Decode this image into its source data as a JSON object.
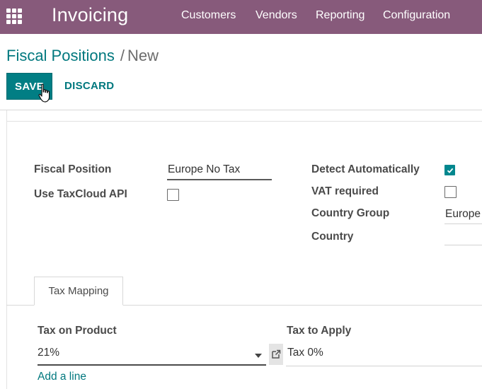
{
  "app": {
    "title": "Invoicing",
    "apps_icon": "grid-apps-icon"
  },
  "nav": {
    "items": [
      "Customers",
      "Vendors",
      "Reporting",
      "Configuration"
    ]
  },
  "breadcrumb": {
    "parent": "Fiscal Positions",
    "separator": "/",
    "current": "New"
  },
  "buttons": {
    "save": "SAVE",
    "discard": "DISCARD"
  },
  "form": {
    "fiscal_position_label": "Fiscal Position",
    "fiscal_position_value": "Europe No Tax",
    "use_taxcloud_label": "Use TaxCloud API",
    "use_taxcloud_checked": false,
    "detect_auto_label": "Detect Automatically",
    "detect_auto_checked": true,
    "vat_required_label": "VAT required",
    "vat_required_checked": false,
    "country_group_label": "Country Group",
    "country_group_value": "Europe",
    "country_label": "Country",
    "country_value": ""
  },
  "tabs": [
    {
      "label": "Tax Mapping",
      "active": true
    }
  ],
  "tax_mapping": {
    "col_product": "Tax on Product",
    "col_apply": "Tax to Apply",
    "row": {
      "product": "21%",
      "apply": "Tax 0%"
    },
    "add_line": "Add a line"
  },
  "colors": {
    "navbar": "#875a7b",
    "primary": "#017e84",
    "link": "#01787e",
    "checkbox_checked": "#01878e"
  },
  "icons": {
    "cursor": "hand-pointer-icon",
    "dropdown": "caret-down-icon",
    "external": "external-link-icon",
    "check": "checkmark-icon"
  }
}
